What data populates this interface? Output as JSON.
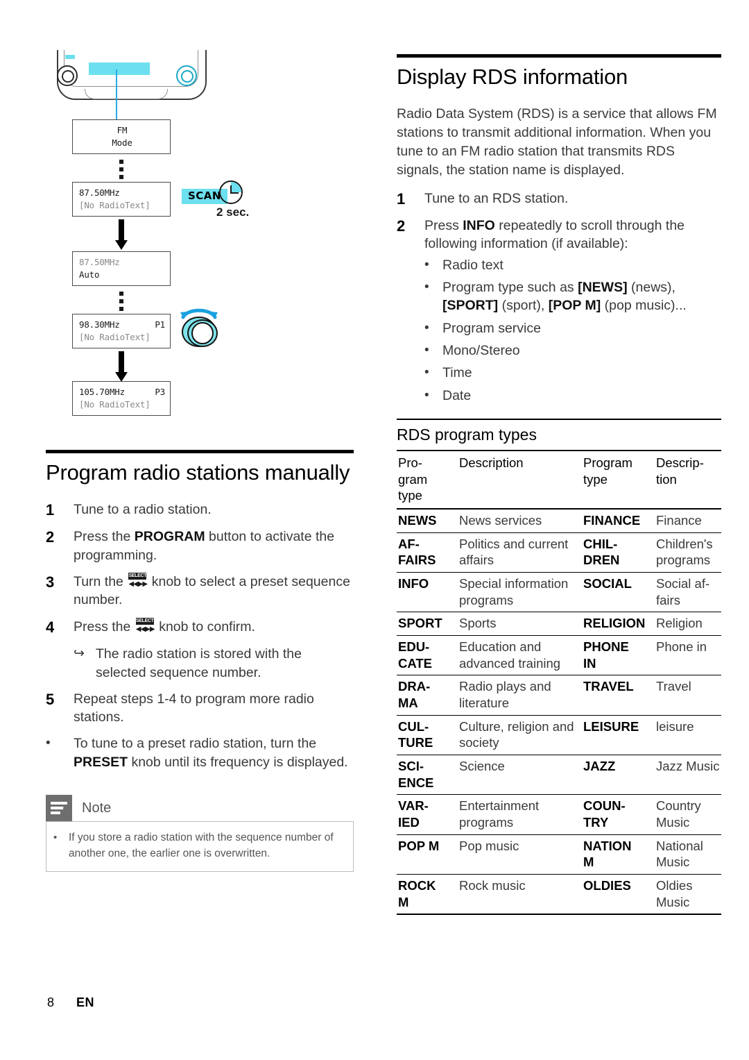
{
  "left_column": {
    "diagram": {
      "device_label": "radio-front-panel",
      "screens": [
        {
          "line1": "FM",
          "line2": "Mode",
          "centered": true
        },
        {
          "line1": "87.50MHz",
          "line2": "[No RadioText]",
          "right1": ""
        },
        {
          "line1": "87.50MHz",
          "line2": "Auto",
          "dim_first": true
        },
        {
          "line1": "98.30MHz",
          "right1": "P1",
          "line2": "[No RadioText]"
        },
        {
          "line1": "105.70MHz",
          "right1": "P3",
          "line2": "[No RadioText]"
        }
      ],
      "scan_button": "SCAN",
      "timer_label": "2 sec."
    },
    "section": {
      "title": "Program radio stations manually",
      "steps": [
        {
          "num": "1",
          "text": "Tune to a radio station."
        },
        {
          "num": "2",
          "pre": "Press the ",
          "bold": "PROGRAM",
          "post": " button to activate the programming."
        },
        {
          "num": "3",
          "pre": "Turn the ",
          "knob": true,
          "post": " knob to select a preset sequence number."
        },
        {
          "num": "4",
          "pre": "Press the ",
          "knob": true,
          "post": " knob to confirm."
        }
      ],
      "sub_result": "The radio station is stored with the selected sequence number.",
      "step5": {
        "num": "5",
        "text": "Repeat steps 1-4 to program more radio stations."
      },
      "final_bullet": {
        "pre": "To tune to a preset radio station, turn the ",
        "bold": "PRESET",
        "post": " knob until its frequency is displayed."
      },
      "knob_icon": {
        "top": "SELECT",
        "bottom": "◀◀▶▶"
      }
    },
    "note": {
      "label": "Note",
      "text": "If you store a radio station with the sequence number of another one, the earlier one is overwritten."
    }
  },
  "right_column": {
    "title": "Display RDS information",
    "intro": "Radio Data System (RDS) is a service that allows FM stations to transmit additional information. When you tune to an FM radio station that transmits RDS signals, the station name is displayed.",
    "steps": [
      {
        "num": "1",
        "text": "Tune to an RDS station."
      },
      {
        "num": "2",
        "pre": "Press ",
        "bold": "INFO",
        "post": " repeatedly to scroll through the following information (if available):"
      }
    ],
    "bullets": [
      {
        "parts": [
          {
            "t": "Radio text"
          }
        ]
      },
      {
        "parts": [
          {
            "t": "Program type such as "
          },
          {
            "t": "[NEWS]",
            "b": true
          },
          {
            "t": " (news), "
          },
          {
            "t": "[SPORT]",
            "b": true
          },
          {
            "t": " (sport), "
          },
          {
            "t": "[POP M]",
            "b": true
          },
          {
            "t": " (pop music)..."
          }
        ]
      },
      {
        "parts": [
          {
            "t": "Program service"
          }
        ]
      },
      {
        "parts": [
          {
            "t": "Mono/Stereo"
          }
        ]
      },
      {
        "parts": [
          {
            "t": "Time"
          }
        ]
      },
      {
        "parts": [
          {
            "t": "Date"
          }
        ]
      }
    ],
    "table": {
      "title": "RDS program types",
      "headers": [
        "Pro-gram type",
        "Description",
        "Program type",
        "Descrip-tion"
      ],
      "headers_display": [
        "Pro-\ngram\ntype",
        "Description",
        "Program\ntype",
        "Descrip-\ntion"
      ],
      "rows": [
        {
          "c1": "NEWS",
          "c2": "News services",
          "c3": "FINANCE",
          "c4": "Finance"
        },
        {
          "c1": "AF-\nFAIRS",
          "c2": "Politics and current affairs",
          "c3": "CHIL-\nDREN",
          "c4": "Children's programs"
        },
        {
          "c1": "INFO",
          "c2": "Special information programs",
          "c3": "SOCIAL",
          "c4": "Social af-fairs"
        },
        {
          "c1": "SPORT",
          "c2": "Sports",
          "c3": "RELIGION",
          "c4": "Religion"
        },
        {
          "c1": "EDU-\nCATE",
          "c2": "Education and advanced training",
          "c3": "PHONE\nIN",
          "c4": "Phone in"
        },
        {
          "c1": "DRA-\nMA",
          "c2": "Radio plays and literature",
          "c3": "TRAVEL",
          "c4": "Travel"
        },
        {
          "c1": "CUL-\nTURE",
          "c2": "Culture, religion and society",
          "c3": "LEISURE",
          "c4": "leisure"
        },
        {
          "c1": "SCI-\nENCE",
          "c2": "Science",
          "c3": "JAZZ",
          "c4": "Jazz Music"
        },
        {
          "c1": "VAR-\nIED",
          "c2": "Entertainment programs",
          "c3": "COUN-\nTRY",
          "c4": "Country Music"
        },
        {
          "c1": "POP M",
          "c2": "Pop music",
          "c3": "NATION\nM",
          "c4": "National Music"
        },
        {
          "c1": "ROCK\nM",
          "c2": "Rock music",
          "c3": "OLDIES",
          "c4": "Oldies Music"
        }
      ]
    }
  },
  "footer": {
    "page": "8",
    "language": "EN"
  },
  "colors": {
    "accent_cyan": "#6ce0ef",
    "lead_blue": "#29abe2",
    "note_gray": "#6e6e6e"
  }
}
